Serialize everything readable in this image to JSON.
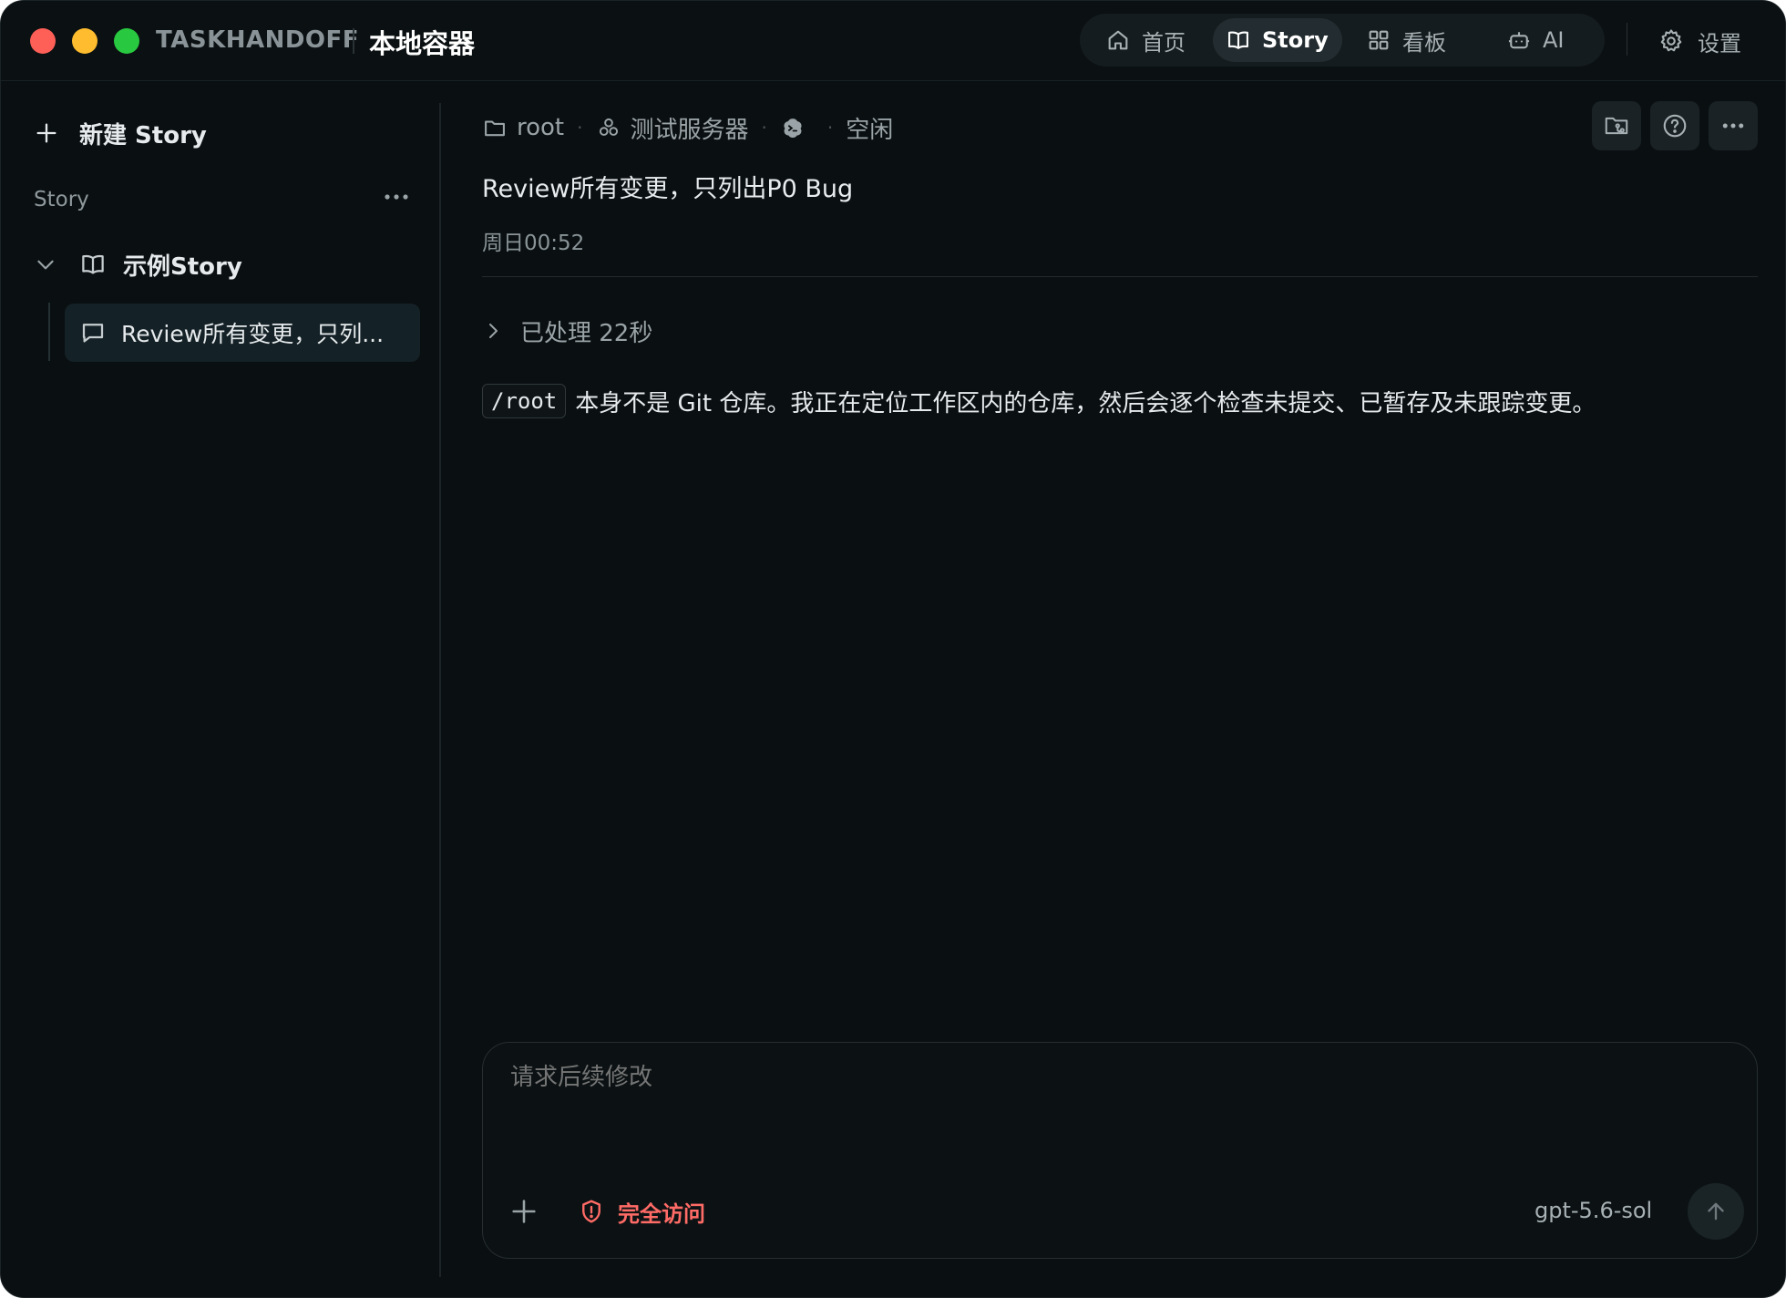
{
  "window": {
    "app_name": "TASKHANDOFF",
    "context_title": "本地容器"
  },
  "nav": {
    "home": "首页",
    "story": "Story",
    "board": "看板",
    "ai": "AI",
    "settings": "设置"
  },
  "sidebar": {
    "new_story": "新建 Story",
    "section_label": "Story",
    "story_name": "示例Story",
    "session_item": "Review所有变更，只列..."
  },
  "breadcrumb": {
    "folder": "root",
    "server": "测试服务器",
    "status": "空闲"
  },
  "thread": {
    "title": "Review所有变更，只列出P0 Bug",
    "time": "周日00:52",
    "processed": "已处理 22秒",
    "message_code": "/root",
    "message_text": "本身不是 Git 仓库。我正在定位工作区内的仓库，然后会逐个检查未提交、已暂存及未跟踪变更。"
  },
  "composer": {
    "placeholder": "请求后续修改",
    "access_label": "完全访问",
    "model": "gpt-5.6-sol"
  },
  "colors": {
    "background": "#0a0f11",
    "active_nav": "#232c30",
    "selected_item": "#142126",
    "danger": "#ff6b66"
  },
  "icons": {
    "home": "home-icon",
    "story": "book-icon",
    "board": "grid-icon",
    "ai": "robot-icon",
    "settings": "gear-icon"
  }
}
